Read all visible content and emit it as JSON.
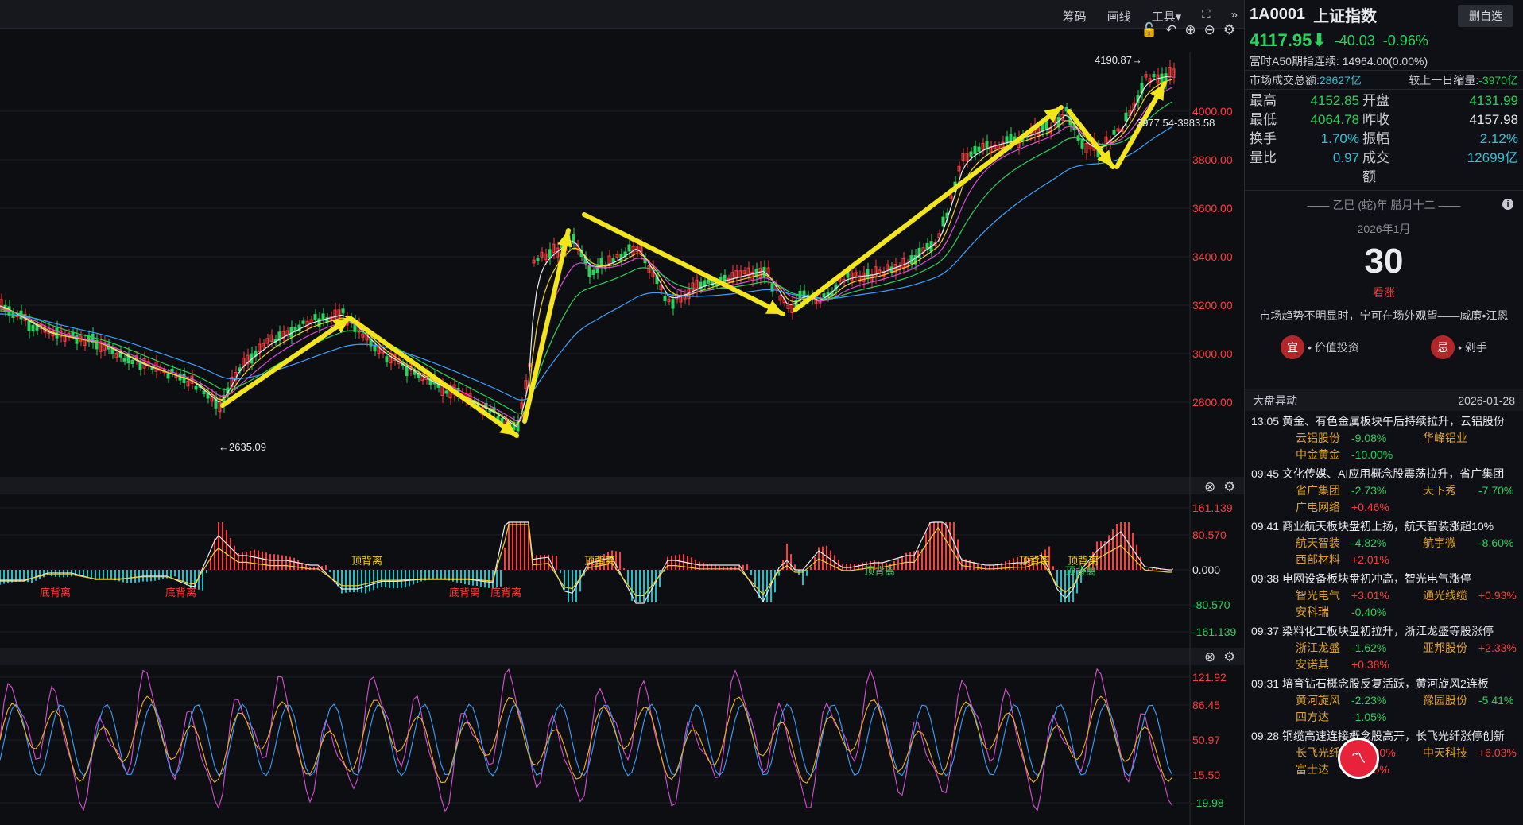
{
  "toolbar": {
    "chips": "筹码",
    "draw": "画线",
    "tools": "工具",
    "tools_arrow": "▾",
    "collapse": "»"
  },
  "chart": {
    "high_label": "4190.87→",
    "low_label": "←2635.09",
    "ma_label": "3977.54-3983.58",
    "price_axis": [
      "4000.00",
      "3800.00",
      "3600.00",
      "3400.00",
      "3200.00",
      "3000.00",
      "2800.00"
    ],
    "macd_axis": [
      "161.139",
      "80.570",
      "0.000",
      "-80.570",
      "-161.139"
    ],
    "kdj_axis": [
      "121.92",
      "86.45",
      "50.97",
      "15.50",
      "-19.98"
    ],
    "macd_labels": {
      "bottom": [
        "底背离",
        "底背离",
        "底背离",
        "底背离"
      ],
      "top": [
        "顶背离",
        "顶背离",
        "顶背离",
        "顶背离"
      ],
      "top_green": [
        "顶背离",
        "顶背离"
      ]
    }
  },
  "quote": {
    "code": "1A0001",
    "name": "上证指数",
    "watch_button": "删自选",
    "price": "4117.95",
    "arrow": "⬇",
    "change": "-40.03",
    "change_pct": "-0.96%",
    "a50_label": "富时A50期指连续:",
    "a50_value": "14964.00(0.00%)",
    "turnover_label": "市场成交总额:",
    "turnover_value": "28627亿",
    "volchg_label": "较上一日缩量:",
    "volchg_value": "-3970亿",
    "high_label": "最高",
    "high": "4152.85",
    "open_label": "开盘",
    "open": "4131.99",
    "low_label": "最低",
    "low": "4064.78",
    "prev_label": "昨收",
    "prev": "4157.98",
    "turn_label": "换手",
    "turn": "1.70%",
    "amp_label": "振幅",
    "amp": "2.12%",
    "vr_label": "量比",
    "vr": "0.97",
    "amount_label": "成交额",
    "amount": "12699亿"
  },
  "calendar": {
    "lunar": "乙巳 (蛇)年 腊月十二",
    "year_month": "2026年1月",
    "day": "30",
    "trend": "看涨",
    "quote": "市场趋势不明显时，宁可在场外观望——威廉•江恩",
    "yi_badge": "宜",
    "yi_text": "• 价值投资",
    "ji_badge": "忌",
    "ji_text": "• 剁手",
    "info": "i"
  },
  "news": {
    "header": "大盘异动",
    "date": "2026-01-28",
    "items": [
      {
        "time": "13:05",
        "title": "黄金、有色金属板块午后持续拉升，云铝股份",
        "stocks": [
          [
            "云铝股份",
            "-9.08%",
            "华峰铝业",
            ""
          ],
          [
            "中金黄金",
            "-10.00%",
            "",
            ""
          ]
        ]
      },
      {
        "time": "09:45",
        "title": "文化传媒、AI应用概念股震荡拉升，省广集团",
        "stocks": [
          [
            "省广集团",
            "-2.73%",
            "天下秀",
            "-7.70%"
          ],
          [
            "广电网络",
            "+0.46%",
            "",
            ""
          ]
        ]
      },
      {
        "time": "09:41",
        "title": "商业航天板块盘初上扬，航天智装涨超10%",
        "stocks": [
          [
            "航天智装",
            "-4.82%",
            "航宇微",
            "-8.60%"
          ],
          [
            "西部材料",
            "+2.01%",
            "",
            ""
          ]
        ]
      },
      {
        "time": "09:38",
        "title": "电网设备板块盘初冲高，智光电气涨停",
        "stocks": [
          [
            "智光电气",
            "+3.01%",
            "通光线缆",
            "+0.93%"
          ],
          [
            "安科瑞",
            "-0.40%",
            "",
            ""
          ]
        ]
      },
      {
        "time": "09:37",
        "title": "染料化工板块盘初拉升，浙江龙盛等股涨停",
        "stocks": [
          [
            "浙江龙盛",
            "-1.62%",
            "亚邦股份",
            "+2.33%"
          ],
          [
            "安诺其",
            "+0.38%",
            "",
            ""
          ]
        ]
      },
      {
        "time": "09:31",
        "title": "培育钻石概念股反复活跃，黄河旋风2连板",
        "stocks": [
          [
            "黄河旋风",
            "-2.23%",
            "豫园股份",
            "-5.41%"
          ],
          [
            "四方达",
            "-1.05%",
            "",
            ""
          ]
        ]
      },
      {
        "time": "09:28",
        "title": "铜缆高速连接概念股高开，长飞光纤涨停创新",
        "stocks": [
          [
            "长飞光纤",
            "+10.00%",
            "中天科技",
            "+6.03%"
          ],
          [
            "富士达",
            "+7.35%",
            "",
            ""
          ]
        ]
      }
    ]
  }
}
